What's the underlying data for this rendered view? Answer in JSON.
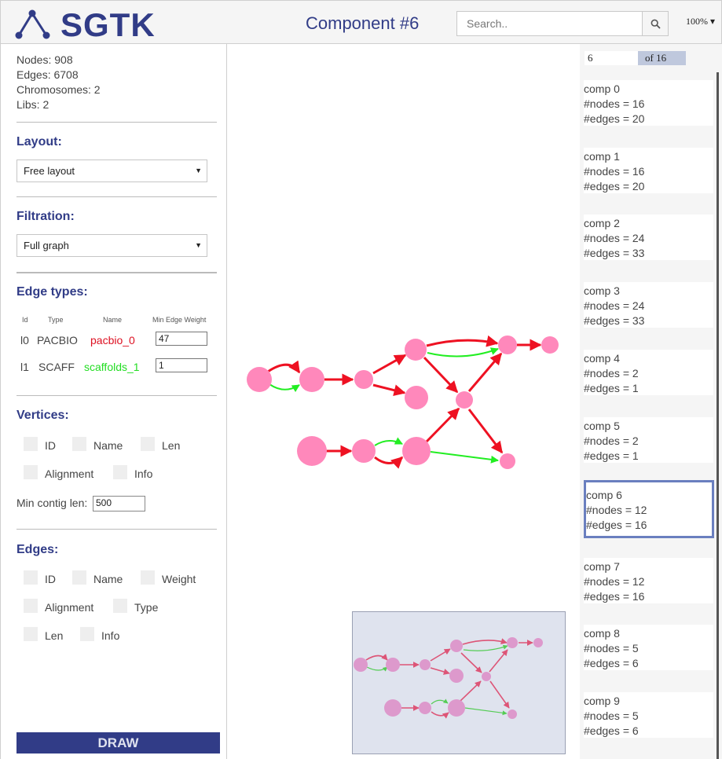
{
  "header": {
    "logo_text": "SGTK",
    "title": "Component #6",
    "search_placeholder": "Search..",
    "zoom": "100% ▾"
  },
  "stats": {
    "nodes": "Nodes: 908",
    "edges": "Edges: 6708",
    "chromosomes": "Chromosomes: 2",
    "libs": "Libs: 2"
  },
  "layout": {
    "title": "Layout:",
    "selected": "Free layout"
  },
  "filtration": {
    "title": "Filtration:",
    "selected": "Full graph"
  },
  "edge_types": {
    "title": "Edge types:",
    "headers": {
      "id": "Id",
      "type": "Type",
      "name": "Name",
      "weight": "Min Edge Weight"
    },
    "rows": [
      {
        "id": "l0",
        "type": "PACBIO",
        "name": "pacbio_0",
        "name_color": "#dd1122",
        "weight": "47"
      },
      {
        "id": "l1",
        "type": "SCAFF",
        "name": "scaffolds_1",
        "name_color": "#22dd22",
        "weight": "1"
      }
    ]
  },
  "vertices": {
    "title": "Vertices:",
    "options": [
      "ID",
      "Name",
      "Len",
      "Alignment",
      "Info"
    ],
    "min_contig_label": "Min contig len:",
    "min_contig_value": "500"
  },
  "edges": {
    "title": "Edges:",
    "options": [
      "ID",
      "Name",
      "Weight",
      "Alignment",
      "Type",
      "Len",
      "Info"
    ]
  },
  "draw_button": "DRAW",
  "pager": {
    "current": "6",
    "total": "of 16"
  },
  "components": [
    {
      "name": "comp 0",
      "nodes": "#nodes = 16",
      "edges": "#edges = 20"
    },
    {
      "name": "comp 1",
      "nodes": "#nodes = 16",
      "edges": "#edges = 20"
    },
    {
      "name": "comp 2",
      "nodes": "#nodes = 24",
      "edges": "#edges = 33"
    },
    {
      "name": "comp 3",
      "nodes": "#nodes = 24",
      "edges": "#edges = 33"
    },
    {
      "name": "comp 4",
      "nodes": "#nodes = 2",
      "edges": "#edges = 1"
    },
    {
      "name": "comp 5",
      "nodes": "#nodes = 2",
      "edges": "#edges = 1"
    },
    {
      "name": "comp 6",
      "nodes": "#nodes = 12",
      "edges": "#edges = 16",
      "selected": true
    },
    {
      "name": "comp 7",
      "nodes": "#nodes = 12",
      "edges": "#edges = 16"
    },
    {
      "name": "comp 8",
      "nodes": "#nodes = 5",
      "edges": "#edges = 6"
    },
    {
      "name": "comp 9",
      "nodes": "#nodes = 5",
      "edges": "#edges = 6"
    }
  ],
  "colors": {
    "accent": "#313c87",
    "node": "#ff88bb",
    "pacbio_edge": "#ee1122",
    "scaffold_edge": "#22ee22",
    "selected_border": "#6a7fbf"
  }
}
